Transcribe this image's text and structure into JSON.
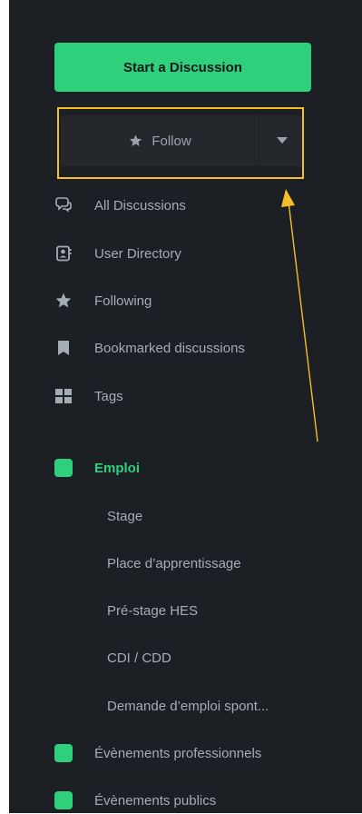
{
  "colors": {
    "sidebar_bg": "#1c1f23",
    "accent": "#2fd07c",
    "text_muted": "#a4adb6",
    "annotation": "#f5bf2a"
  },
  "start_button": {
    "label": "Start a Discussion"
  },
  "follow": {
    "label": "Follow",
    "icon": "star-icon",
    "caret_icon": "caret-down-icon"
  },
  "nav": [
    {
      "label": "All Discussions",
      "icon": "comments-icon"
    },
    {
      "label": "User Directory",
      "icon": "address-book-icon"
    },
    {
      "label": "Following",
      "icon": "star-icon"
    },
    {
      "label": "Bookmarked discussions",
      "icon": "bookmark-icon"
    },
    {
      "label": "Tags",
      "icon": "tags-grid-icon"
    }
  ],
  "tags": [
    {
      "label": "Emploi",
      "active": true,
      "color": "#2fd07c"
    },
    {
      "label": "Évènements professionnels",
      "color": "#2fd07c"
    },
    {
      "label": "Évènements publics",
      "color": "#2fd07c"
    }
  ],
  "subtags": [
    {
      "label": "Stage"
    },
    {
      "label": "Place d’apprentissage"
    },
    {
      "label": "Pré-stage HES"
    },
    {
      "label": "CDI / CDD"
    },
    {
      "label": "Demande d’emploi spont..."
    }
  ]
}
